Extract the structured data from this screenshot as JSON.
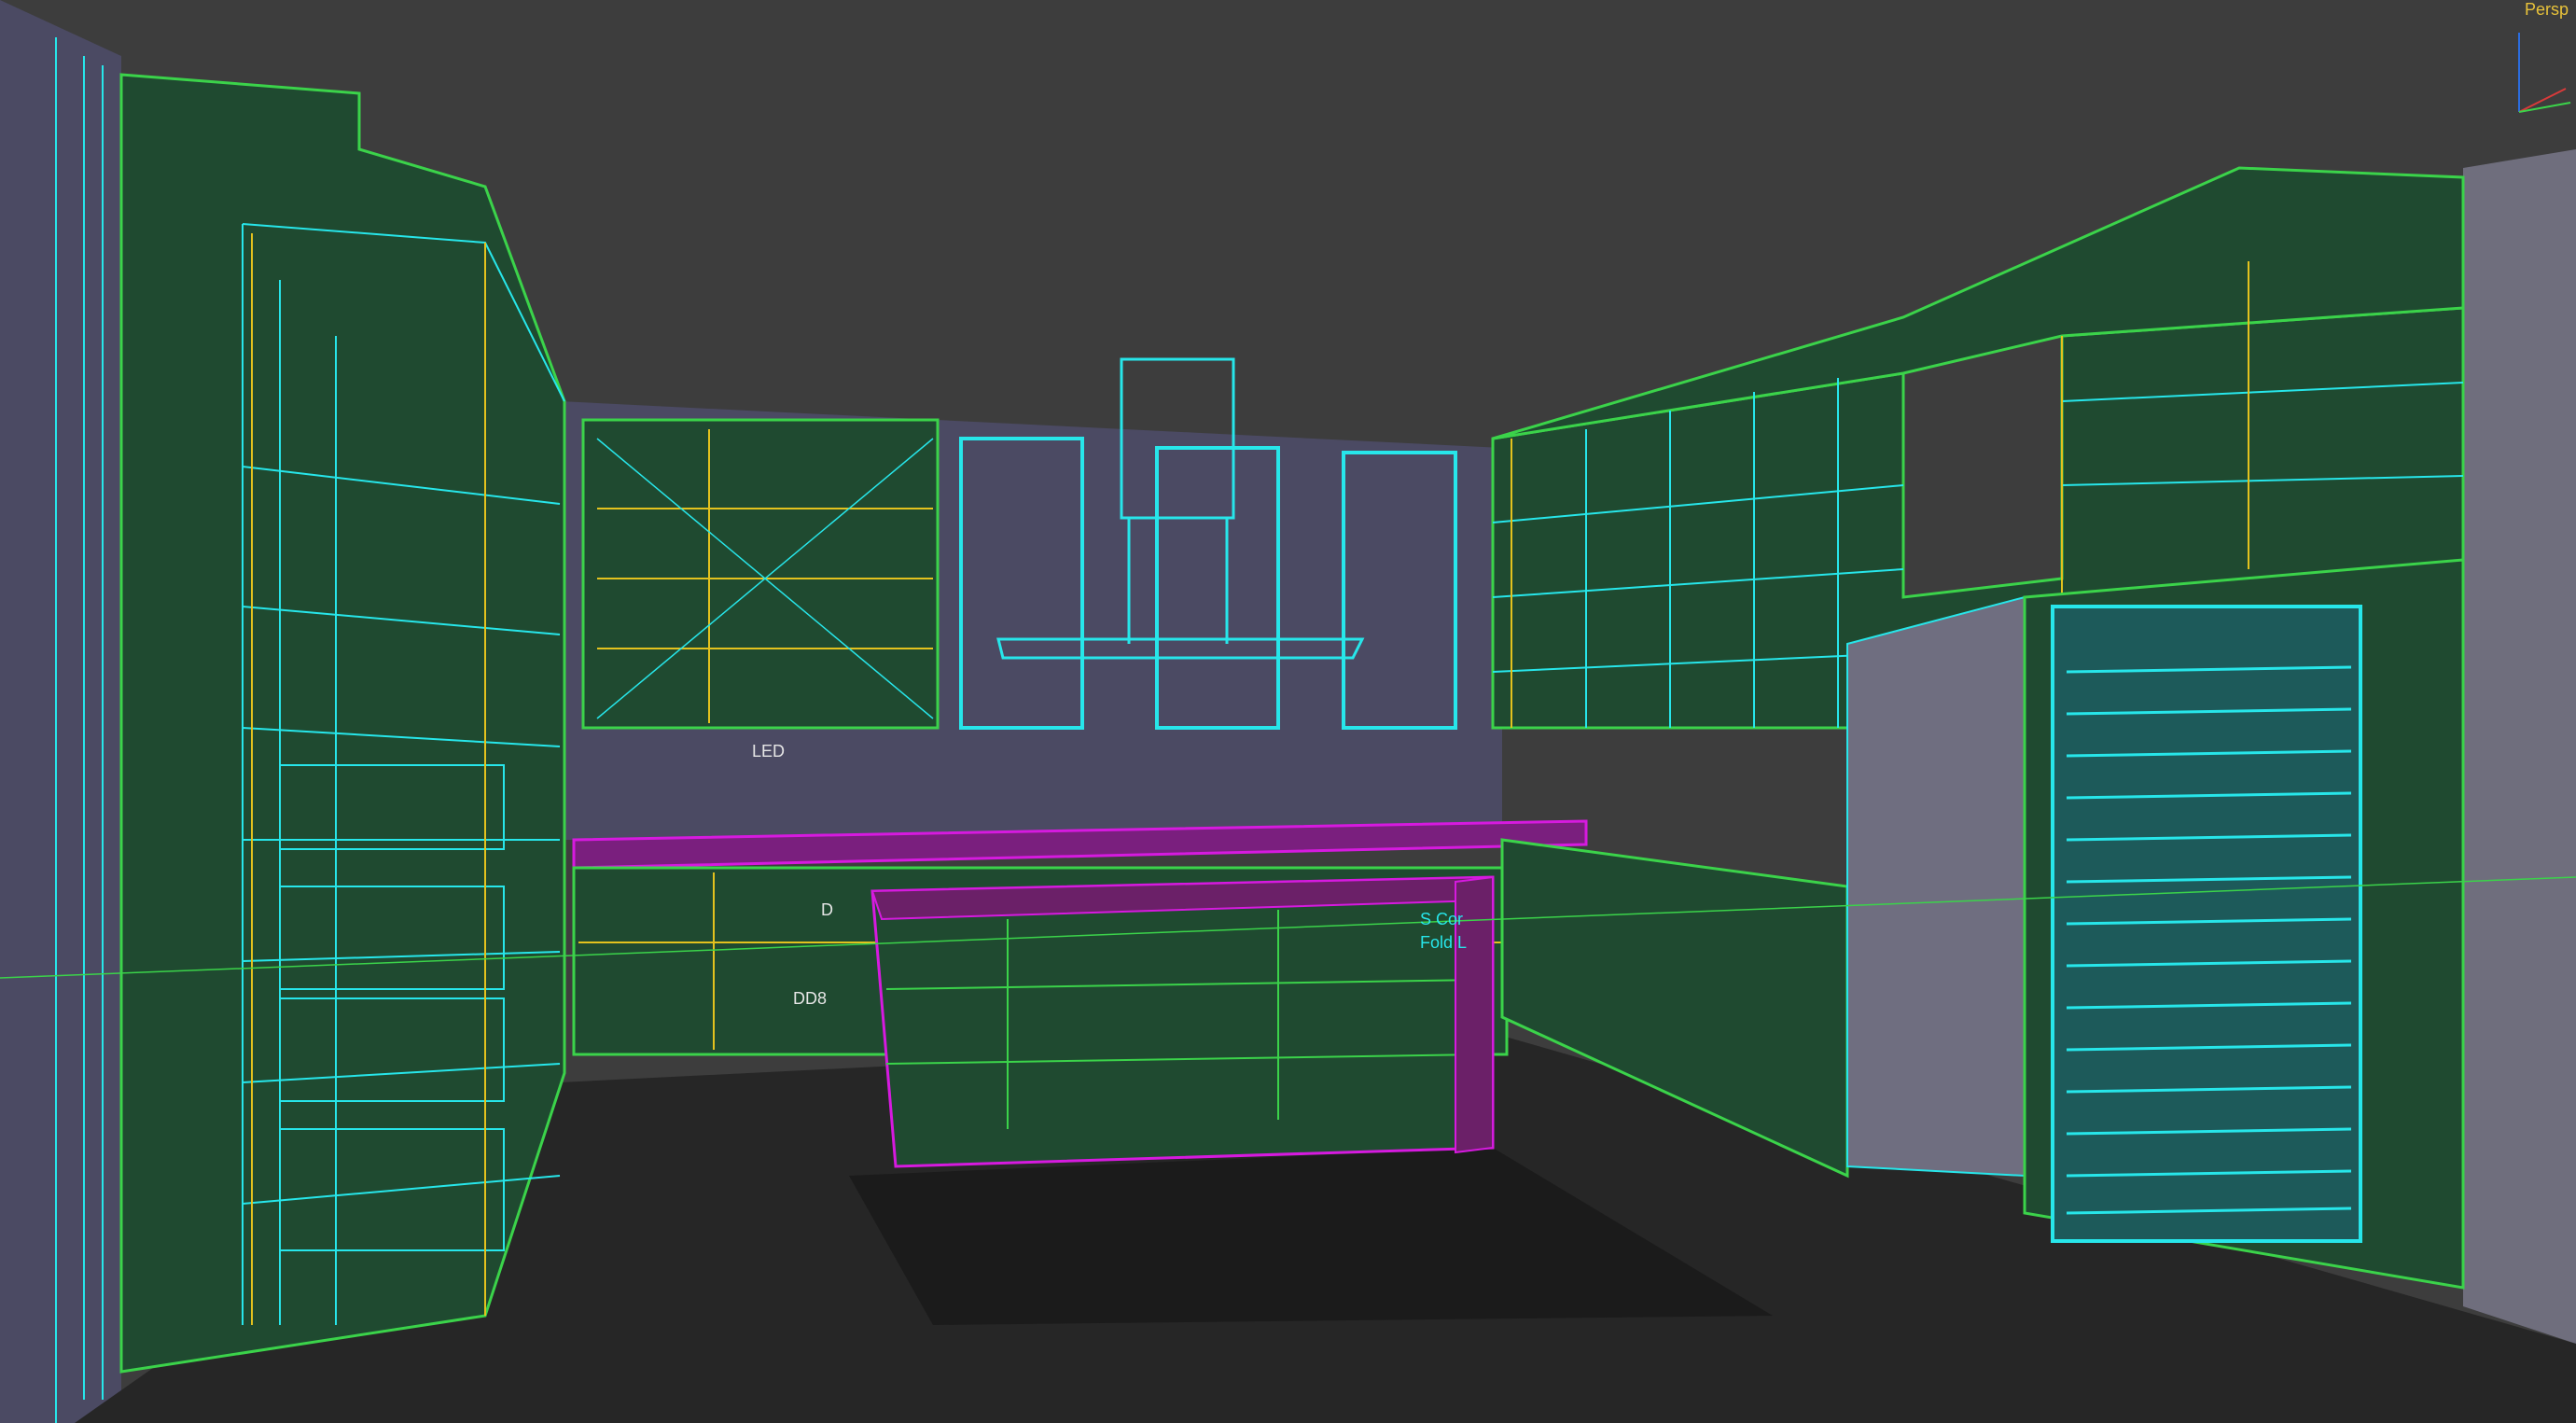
{
  "viewport": {
    "label": "Persp",
    "background": "#3d3d3d"
  },
  "colors": {
    "cabinet_fill": "#1f4a30",
    "wireframe_green": "#3bd34a",
    "wireframe_cyan": "#27e6ea",
    "wireframe_yellow": "#e3c21e",
    "wireframe_magenta": "#d61adf",
    "wall": "#4b4a63",
    "floor": "#262626",
    "shadow": "#1a1a1a"
  },
  "annotations": {
    "led": "LED",
    "d": "D",
    "dd8": "DD8",
    "s_cor": "S Cor",
    "fold_l": "Fold L"
  },
  "gizmo": {
    "icon": "axis-gizmo-icon"
  }
}
